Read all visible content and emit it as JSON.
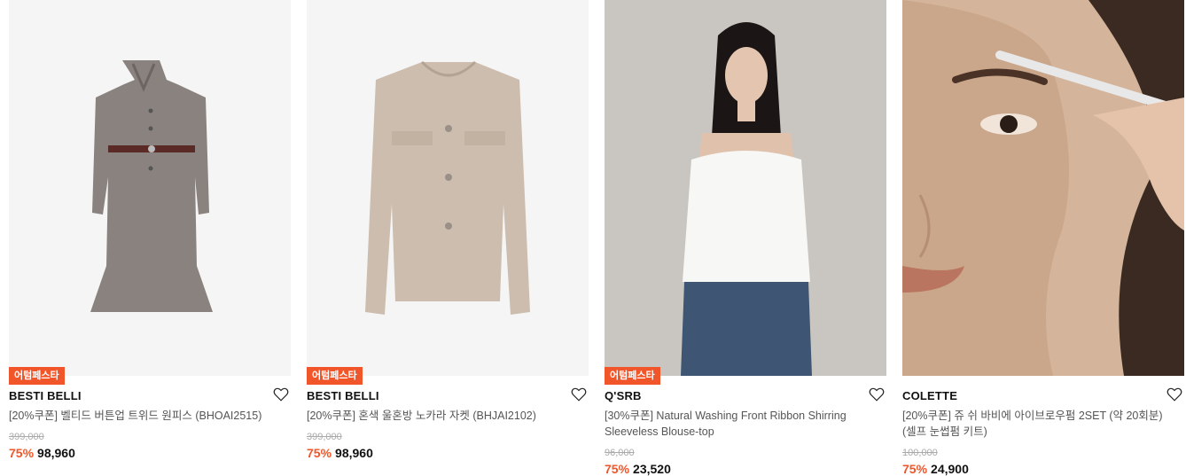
{
  "products": [
    {
      "badge": "어텀페스타",
      "brand": "BESTI BELLI",
      "title": "[20%쿠폰] 벨티드 버튼업 트위드 원피스 (BHOAI2515)",
      "original_price": "399,000",
      "discount": "75%",
      "price": "98,960",
      "image": "tweed-dress-photo",
      "bg_color": "#f5f5f5"
    },
    {
      "badge": "어텀페스타",
      "brand": "BESTI BELLI",
      "title": "[20%쿠폰] 혼색 울혼방 노카라 자켓 (BHJAI2102)",
      "original_price": "399,000",
      "discount": "75%",
      "price": "98,960",
      "image": "collarless-jacket-photo",
      "bg_color": "#f5f5f5"
    },
    {
      "badge": "어텀페스타",
      "brand": "Q'SRB",
      "title": "[30%쿠폰] Natural Washing Front Ribbon Shirring Sleeveless Blouse-top",
      "original_price": "96,000",
      "discount": "75%",
      "price": "23,520",
      "image": "model-white-blouse-photo",
      "bg_color": "#c9c6c1"
    },
    {
      "badge": "",
      "brand": "COLETTE",
      "title": "[20%쿠폰] 쥬 쉬 바비에 아이브로우펌 2SET (약 20회분) (셀프 눈썹펌 키트)",
      "original_price": "100,000",
      "discount": "75%",
      "price": "24,900",
      "image": "eyebrow-closeup-photo",
      "bg_color": "#caa68a"
    }
  ],
  "colors": {
    "accent": "#f0562a",
    "muted": "#aaaaaa"
  }
}
